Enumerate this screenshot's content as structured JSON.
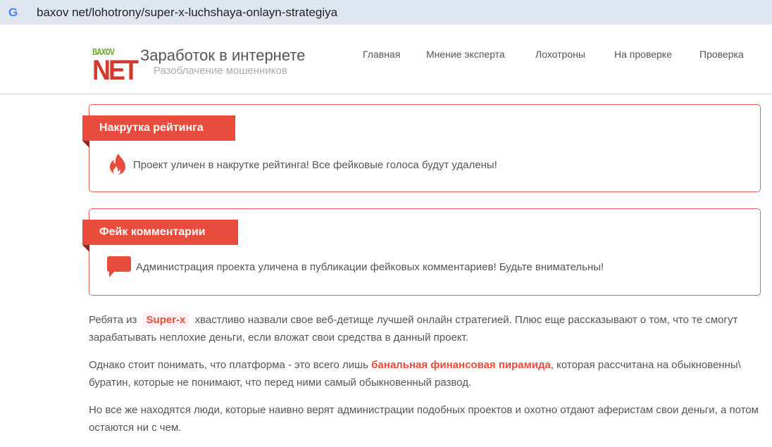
{
  "browser": {
    "url": "baxov net/lohotrony/super-x-luchshaya-onlayn-strategiya"
  },
  "header": {
    "logo_top": "BAXOV",
    "logo_bottom": "NET",
    "title": "Заработок в интернете",
    "subtitle": "Разоблачение мошенников",
    "nav": [
      "Главная",
      "Мнение эксперта",
      "Лохотроны",
      "На проверке",
      "Проверка"
    ]
  },
  "alerts": [
    {
      "label": "Накрутка рейтинга",
      "icon": "fire-icon",
      "text": "Проект уличен в накрутке рейтинга! Все фейковые голоса будут удалены!"
    },
    {
      "label": "Фейк комментарии",
      "icon": "comment-icon",
      "text": "Администрация проекта уличена в публикации фейковых комментариев! Будьте внимательны!"
    }
  ],
  "article": {
    "p1_a": "Ребята из",
    "p1_tag": "Super-x",
    "p1_b": "хвастливо назвали свое веб-детище лучшей онлайн стратегией. Плюс еще рассказывают о том, что те смогут зарабатывать неплохие деньги, если вложат свои средства в данный проект.",
    "p2_a": "Однако стоит понимать, что платформа - это всего лишь",
    "p2_hl": "банальная финансовая пирамида",
    "p2_b": ", которая рассчитана на обыкновенны\\ буратин, которые не понимают, что перед ними самый обыкновенный развод.",
    "p3": "Но все же находятся люди, которые наивно верят администрации подобных проектов и охотно отдают аферистам свои деньги, а потом остаются ни с чем."
  },
  "colors": {
    "accent": "#e84c3d"
  }
}
